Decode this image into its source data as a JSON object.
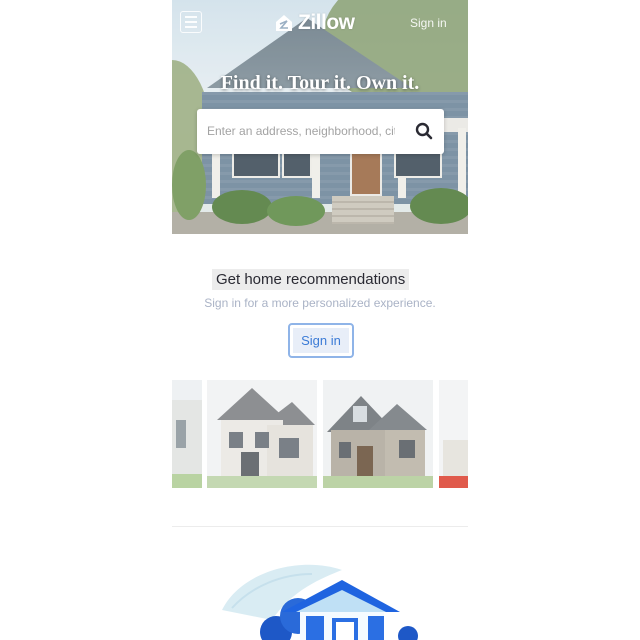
{
  "header": {
    "logo_text": "Zillow",
    "signin_label": "Sign in",
    "menu_icon": "hamburger-menu-icon"
  },
  "hero": {
    "tagline": "Find it. Tour it. Own it.",
    "search_placeholder": "Enter an address, neighborhood, city, or ZIP code",
    "search_icon": "search-icon"
  },
  "recommendations": {
    "title": "Get home recommendations",
    "subtitle": "Sign in for a more personalized experience.",
    "signin_button": "Sign in"
  },
  "colors": {
    "brand_blue": "#006aff",
    "link_blue": "#3b7bd6",
    "muted_text": "#aab3c6"
  }
}
